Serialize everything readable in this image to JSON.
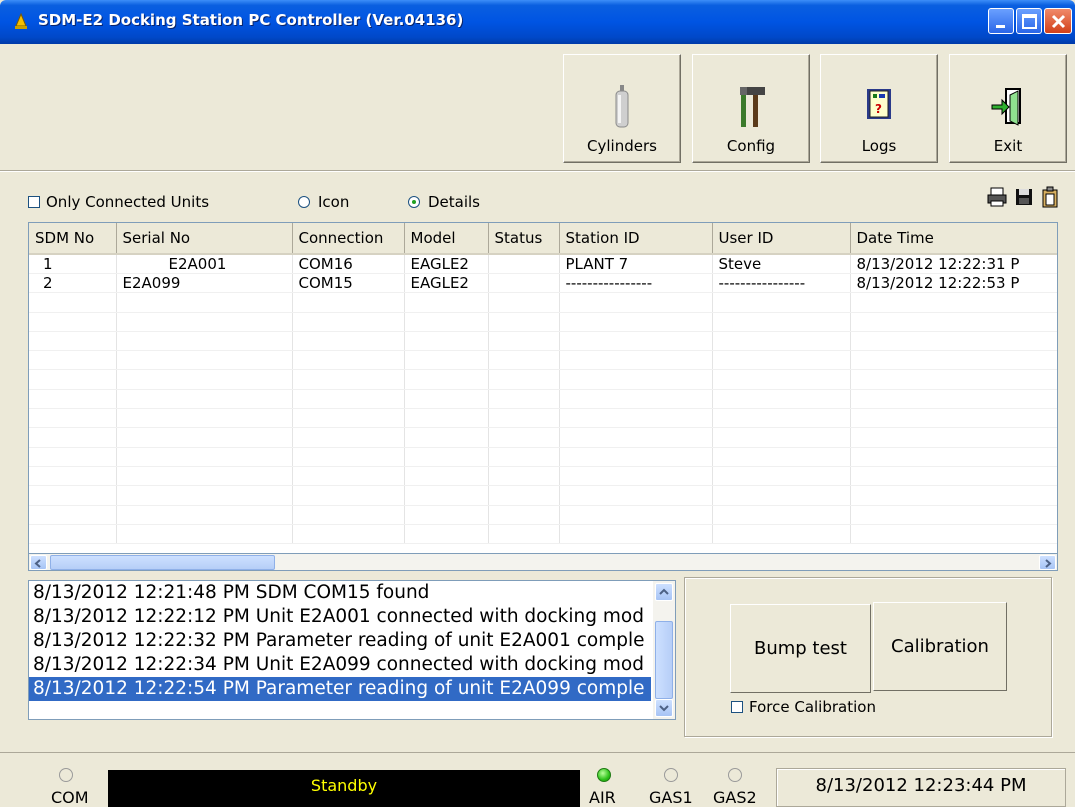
{
  "window": {
    "title": "SDM-E2 Docking Station PC Controller (Ver.04136)",
    "app_icon": "bell-warning-icon"
  },
  "toolbar": {
    "cylinders_label": "Cylinders",
    "config_label": "Config",
    "logs_label": "Logs",
    "exit_label": "Exit"
  },
  "options": {
    "only_connected_label": "Only Connected Units",
    "only_connected_checked": false,
    "view_icon_label": "Icon",
    "view_details_label": "Details",
    "selected_view": "Details"
  },
  "grid": {
    "columns": [
      "SDM No",
      "Serial No",
      "Connection",
      "Model",
      "Status",
      "Station ID",
      "User ID",
      "Date Time"
    ],
    "rows": [
      [
        "1",
        "E2A001",
        "COM16",
        "EAGLE2",
        "",
        "PLANT 7",
        "Steve",
        "8/13/2012 12:22:31 P"
      ],
      [
        "2",
        "E2A099",
        "COM15",
        "EAGLE2",
        "",
        "----------------",
        "----------------",
        "8/13/2012 12:22:53 P"
      ]
    ]
  },
  "log": {
    "lines": [
      "8/13/2012 12:21:48 PM SDM COM15 found",
      "8/13/2012 12:22:12 PM Unit E2A001 connected with docking mod",
      "8/13/2012 12:22:32 PM Parameter reading of unit E2A001 comple",
      "8/13/2012 12:22:34 PM Unit E2A099 connected with docking mod",
      "8/13/2012 12:22:54 PM Parameter reading of unit E2A099 comple"
    ],
    "selected_index": 4
  },
  "actions": {
    "bump_label": "Bump test",
    "calibration_label": "Calibration",
    "force_label": "Force Calibration",
    "force_checked": false
  },
  "statusbar": {
    "com_label": "COM",
    "status_text": "Standby",
    "air_label": "AIR",
    "gas1_label": "GAS1",
    "gas2_label": "GAS2",
    "clock": "8/13/2012 12:23:44 PM",
    "air_on": true,
    "status_color": "#ffff00"
  },
  "colors": {
    "titlebar": "#0054e3",
    "selection": "#316ac5",
    "led_on": "#2ec21a"
  }
}
